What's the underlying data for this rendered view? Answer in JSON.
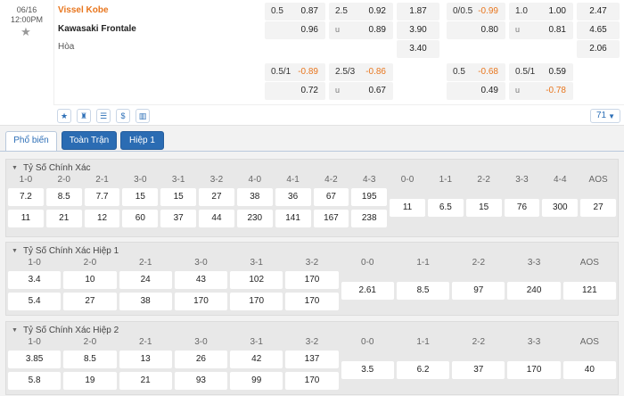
{
  "match": {
    "date": "06/16",
    "time": "12:00PM",
    "home": "Vissel Kobe",
    "away": "Kawasaki Frontale",
    "draw": "Hòa",
    "more_count": "71",
    "ft_row1": [
      {
        "l": "0.5",
        "r": "0.87"
      },
      {
        "l": "2.5",
        "r": "0.92"
      },
      {
        "c": "1.87"
      },
      {
        "l": "0/0.5",
        "r": "-0.99",
        "neg": true
      },
      {
        "l": "1.0",
        "r": "1.00"
      },
      {
        "c": "2.47"
      }
    ],
    "ft_row2": [
      {
        "l": "",
        "r": "0.96"
      },
      {
        "l": "u",
        "r": "0.89"
      },
      {
        "c": "3.90"
      },
      {
        "l": "",
        "r": "0.80"
      },
      {
        "l": "u",
        "r": "0.81"
      },
      {
        "c": "4.65"
      }
    ],
    "ft_row3": [
      {
        "c": "3.40"
      },
      {
        "c": "2.06"
      }
    ],
    "alt_row1": [
      {
        "l": "0.5/1",
        "r": "-0.89",
        "neg": true
      },
      {
        "l": "2.5/3",
        "r": "-0.86",
        "neg": true
      },
      {
        "l": "0.5",
        "r": "-0.68",
        "neg": true
      },
      {
        "l": "0.5/1",
        "r": "0.59"
      }
    ],
    "alt_row2": [
      {
        "l": "",
        "r": "0.72"
      },
      {
        "l": "u",
        "r": "0.67"
      },
      {
        "l": "",
        "r": "0.49"
      },
      {
        "l": "u",
        "r": "-0.78",
        "neg": true
      }
    ]
  },
  "tabs": [
    "Phổ biến",
    "Toàn Trận",
    "Hiệp 1"
  ],
  "sections": [
    {
      "title": "Tỷ Số Chính Xác",
      "headers": [
        "1-0",
        "2-0",
        "2-1",
        "3-0",
        "3-1",
        "3-2",
        "4-0",
        "4-1",
        "4-2",
        "4-3",
        "0-0",
        "1-1",
        "2-2",
        "3-3",
        "4-4",
        "AOS"
      ],
      "row1": [
        "7.2",
        "8.5",
        "7.7",
        "15",
        "15",
        "27",
        "38",
        "36",
        "67",
        "195"
      ],
      "row2": [
        "11",
        "21",
        "12",
        "60",
        "37",
        "44",
        "230",
        "141",
        "167",
        "238"
      ],
      "draws": [
        "11",
        "6.5",
        "15",
        "76",
        "300",
        "27"
      ]
    },
    {
      "title": "Tỷ Số Chính Xác Hiệp 1",
      "headers": [
        "1-0",
        "2-0",
        "2-1",
        "3-0",
        "3-1",
        "3-2",
        "0-0",
        "1-1",
        "2-2",
        "3-3",
        "AOS"
      ],
      "row1": [
        "3.4",
        "10",
        "24",
        "43",
        "102",
        "170"
      ],
      "row2": [
        "5.4",
        "27",
        "38",
        "170",
        "170",
        "170"
      ],
      "draws": [
        "2.61",
        "8.5",
        "97",
        "240",
        "121"
      ]
    },
    {
      "title": "Tỷ Số Chính Xác Hiệp 2",
      "headers": [
        "1-0",
        "2-0",
        "2-1",
        "3-0",
        "3-1",
        "3-2",
        "0-0",
        "1-1",
        "2-2",
        "3-3",
        "AOS"
      ],
      "row1": [
        "3.85",
        "8.5",
        "13",
        "26",
        "42",
        "137"
      ],
      "row2": [
        "5.8",
        "19",
        "21",
        "93",
        "99",
        "170"
      ],
      "draws": [
        "3.5",
        "6.2",
        "37",
        "170",
        "40"
      ]
    }
  ],
  "icons": [
    "star-icon",
    "shirt-icon",
    "scoreboard-icon",
    "dollar-icon",
    "stats-icon"
  ],
  "colors": {
    "accent": "#e8761e",
    "blue": "#2b6cb3"
  }
}
